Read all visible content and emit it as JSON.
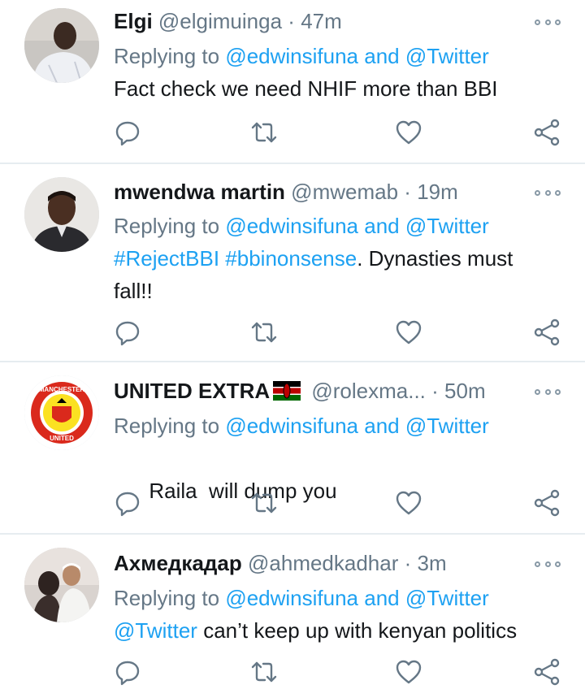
{
  "colors": {
    "link": "#1da1f2",
    "muted": "#657786",
    "text": "#14171a",
    "divider": "#e6ecf0"
  },
  "tweets": [
    {
      "name": "Elgi",
      "handle": "@elgimuinga",
      "dot": "·",
      "time": "47m",
      "replying_prefix": "Replying to ",
      "replying_links": "@edwinsifuna and @Twitter",
      "body_link": "",
      "body_text": "Fact check we need NHIF more than BBI"
    },
    {
      "name": "mwendwa martin",
      "handle": "@mwemab",
      "dot": "·",
      "time": "19m",
      "replying_prefix": "Replying to ",
      "replying_links": "@edwinsifuna and @Twitter",
      "body_link": "#RejectBBI #bbinonsense",
      "body_text": ". Dynasties must fall!!"
    },
    {
      "name": "UNITED EXTRA",
      "handle": "@rolexma...",
      "dot": "·",
      "time": "50m",
      "replying_prefix": "Replying to ",
      "replying_links": "@edwinsifuna and @Twitter",
      "body_link": "",
      "body_text": "Raila  will dump you",
      "avatar_text_top": "MANCHESTER",
      "avatar_text_bottom": "UNITED"
    },
    {
      "name": "Ахмедкадар",
      "handle": "@ahmedkadhar",
      "dot": "·",
      "time": "3m",
      "replying_prefix": "Replying to ",
      "replying_links": "@edwinsifuna and @Twitter",
      "body_link": "@Twitter",
      "body_text": " can’t keep up with kenyan politics"
    }
  ],
  "icons": [
    "reply-icon",
    "retweet-icon",
    "like-icon",
    "share-icon",
    "more-icon",
    "kenya-flag-icon"
  ]
}
